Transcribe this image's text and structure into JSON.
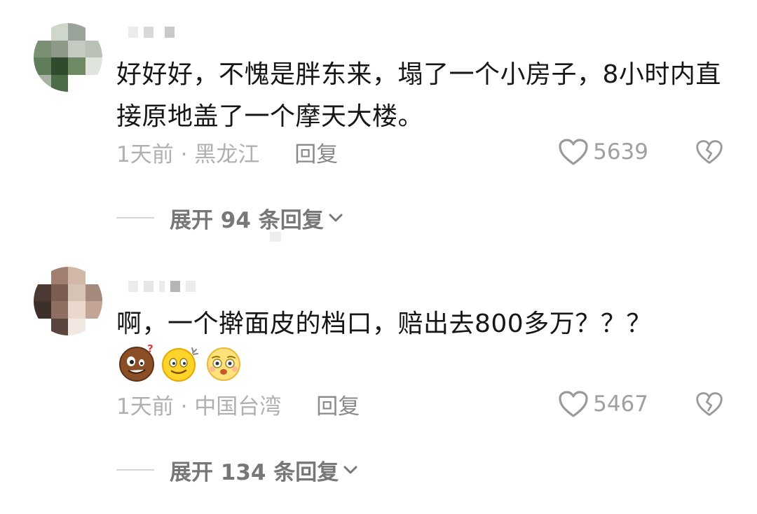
{
  "comments": [
    {
      "text": "好好好，不愧是胖东来，塌了一个小房子，8小时内直接原地盖了一个摩天大楼。",
      "time_location": "1天前 · 黑龙江",
      "reply_label": "回复",
      "like_count": "5639",
      "expand_label": "展开 94 条回复",
      "avatar_colors": [
        "#ffffff",
        "#cfd6cc",
        "#9aa39a",
        "#ffffff",
        "#7b8f74",
        "#8c9a87",
        "#c4c9c1",
        "#b8c1b4",
        "#5f7d59",
        "#2f4a2c",
        "#6f8a64",
        "#dfe5dc",
        "#a7b3a2",
        "#4e6b48",
        "#ffffff",
        "#ffffff"
      ]
    },
    {
      "text": "啊，一个擀面皮的档口，赔出去800多万？？？",
      "time_location": "1天前 · 中国台湾",
      "reply_label": "回复",
      "like_count": "5467",
      "expand_label": "展开 134 条回复",
      "emojis": [
        "confused-face",
        "dizzy-smile-face",
        "pleading-face"
      ],
      "avatar_colors": [
        "#ffffff",
        "#a17f70",
        "#d0b7a8",
        "#ffffff",
        "#4a3a33",
        "#7a5d50",
        "#d7c3b6",
        "#a48a7c",
        "#3d2f2a",
        "#8e6f61",
        "#ead8cc",
        "#c2a597",
        "#ffffff",
        "#5a463d",
        "#f2e8e2",
        "#ffffff"
      ]
    }
  ]
}
